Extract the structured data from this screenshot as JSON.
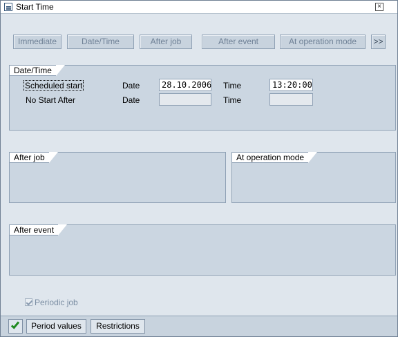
{
  "window": {
    "title": "Start Time",
    "close_icon": "close-icon"
  },
  "toolbar": {
    "immediate": "Immediate",
    "date_time": "Date/Time",
    "after_job": "After job",
    "after_event": "After event",
    "at_operation_mode": "At operation mode",
    "more": ">>"
  },
  "datetime_group": {
    "title": "Date/Time",
    "scheduled_start": {
      "label": "Scheduled start",
      "date_label": "Date",
      "date_value": "28.10.2006",
      "time_label": "Time",
      "time_value": "13:20:00"
    },
    "no_start_after": {
      "label": "No Start After",
      "date_label": "Date",
      "date_value": "",
      "time_label": "Time",
      "time_value": ""
    }
  },
  "after_job_group": {
    "title": "After job"
  },
  "at_operation_mode_group": {
    "title": "At operation mode"
  },
  "after_event_group": {
    "title": "After event"
  },
  "periodic_job": {
    "label": "Periodic job",
    "checked": true,
    "enabled": false
  },
  "footer": {
    "ok_icon": "checkmark-icon",
    "period_values": "Period values",
    "restrictions": "Restrictions"
  },
  "colors": {
    "panel": "#cbd6e1",
    "border": "#8ea0b4",
    "ok_green": "#1f8a1f"
  }
}
